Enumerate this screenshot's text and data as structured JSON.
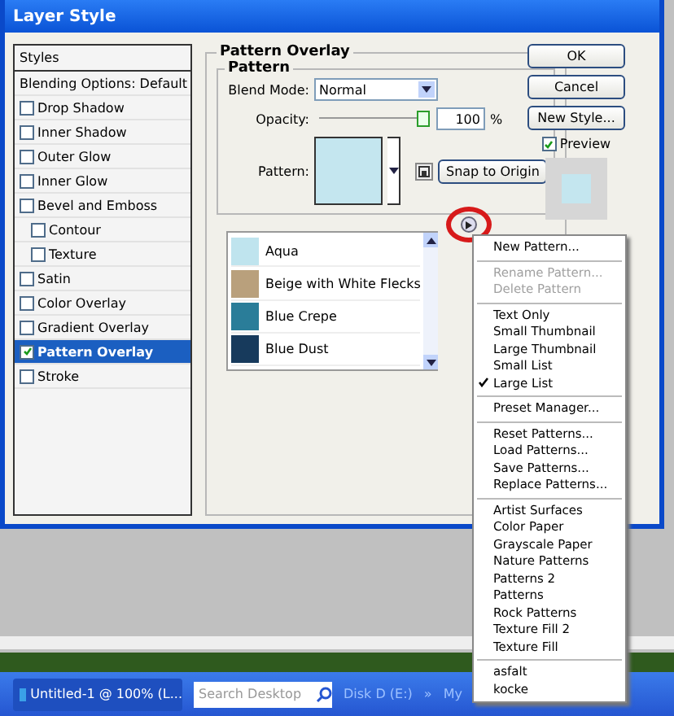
{
  "window": {
    "title": "Layer Style"
  },
  "styles": {
    "header": "Styles",
    "blending_options": "Blending Options: Default",
    "items": [
      {
        "label": "Drop Shadow",
        "checked": false,
        "selected": false
      },
      {
        "label": "Inner Shadow",
        "checked": false,
        "selected": false
      },
      {
        "label": "Outer Glow",
        "checked": false,
        "selected": false
      },
      {
        "label": "Inner Glow",
        "checked": false,
        "selected": false
      },
      {
        "label": "Bevel and Emboss",
        "checked": false,
        "selected": false,
        "children": [
          {
            "label": "Contour",
            "checked": false,
            "selected": false
          },
          {
            "label": "Texture",
            "checked": false,
            "selected": false
          }
        ]
      },
      {
        "label": "Satin",
        "checked": false,
        "selected": false
      },
      {
        "label": "Color Overlay",
        "checked": false,
        "selected": false
      },
      {
        "label": "Gradient Overlay",
        "checked": false,
        "selected": false
      },
      {
        "label": "Pattern Overlay",
        "checked": true,
        "selected": true
      },
      {
        "label": "Stroke",
        "checked": false,
        "selected": false
      }
    ]
  },
  "panel": {
    "title": "Pattern Overlay",
    "group": "Pattern",
    "blend_mode": {
      "label": "Blend Mode:",
      "value": "Normal"
    },
    "opacity": {
      "label": "Opacity:",
      "level": 1.0,
      "value": "100",
      "unit": "%"
    },
    "pattern": {
      "label": "Pattern:",
      "color": "#c4e6ef"
    },
    "snap_button": "Snap to Origin"
  },
  "pattern_list": [
    {
      "name": "Aqua",
      "color": "#bfe4ee",
      "selected": false
    },
    {
      "name": "Beige with White Flecks",
      "color": "#b9a07c",
      "selected": false
    },
    {
      "name": "Blue Crepe",
      "color": "#2a7d99",
      "selected": false
    },
    {
      "name": "Blue Dust",
      "color": "#173a5c",
      "selected": false
    }
  ],
  "buttons": [
    "OK",
    "Cancel",
    "New Style..."
  ],
  "preview": {
    "label": "Preview",
    "checked": true,
    "color": "#c4e6ef"
  },
  "menu": [
    [
      {
        "label": "New Pattern...",
        "disabled": false,
        "checked": false
      }
    ],
    [
      {
        "label": "Rename Pattern...",
        "disabled": true,
        "checked": false
      },
      {
        "label": "Delete Pattern",
        "disabled": true,
        "checked": false
      }
    ],
    [
      {
        "label": "Text Only",
        "disabled": false,
        "checked": false
      },
      {
        "label": "Small Thumbnail",
        "disabled": false,
        "checked": false
      },
      {
        "label": "Large Thumbnail",
        "disabled": false,
        "checked": false
      },
      {
        "label": "Small List",
        "disabled": false,
        "checked": false
      },
      {
        "label": "Large List",
        "disabled": false,
        "checked": true
      }
    ],
    [
      {
        "label": "Preset Manager...",
        "disabled": false,
        "checked": false
      }
    ],
    [
      {
        "label": "Reset Patterns...",
        "disabled": false,
        "checked": false
      },
      {
        "label": "Load Patterns...",
        "disabled": false,
        "checked": false
      },
      {
        "label": "Save Patterns...",
        "disabled": false,
        "checked": false
      },
      {
        "label": "Replace Patterns...",
        "disabled": false,
        "checked": false
      }
    ],
    [
      {
        "label": "Artist Surfaces",
        "disabled": false,
        "checked": false
      },
      {
        "label": "Color Paper",
        "disabled": false,
        "checked": false
      },
      {
        "label": "Grayscale Paper",
        "disabled": false,
        "checked": false
      },
      {
        "label": "Nature Patterns",
        "disabled": false,
        "checked": false
      },
      {
        "label": "Patterns 2",
        "disabled": false,
        "checked": false
      },
      {
        "label": "Patterns",
        "disabled": false,
        "checked": false
      },
      {
        "label": "Rock Patterns",
        "disabled": false,
        "checked": false
      },
      {
        "label": "Texture Fill 2",
        "disabled": false,
        "checked": false
      },
      {
        "label": "Texture Fill",
        "disabled": false,
        "checked": false
      }
    ],
    [
      {
        "label": "asfalt",
        "disabled": false,
        "checked": false
      },
      {
        "label": "kocke",
        "disabled": false,
        "checked": false
      }
    ]
  ],
  "taskbar": {
    "task": "Untitled-1 @ 100% (L...",
    "search_placeholder": "Search Desktop",
    "drive": "Disk D (E:)",
    "chevron": "»",
    "partial": "My"
  }
}
